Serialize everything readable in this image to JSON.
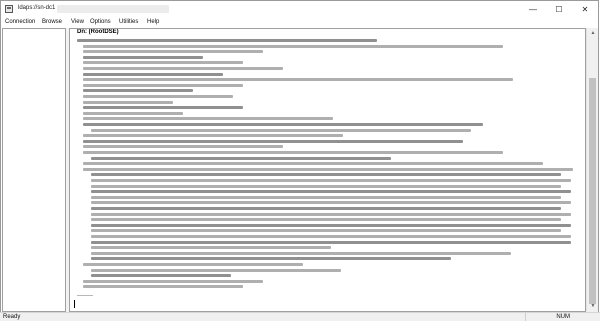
{
  "window": {
    "title_prefix": "ldaps://sn-dc1",
    "minimize_glyph": "—",
    "maximize_glyph": "☐",
    "close_glyph": "✕"
  },
  "menu": [
    "Connection",
    "Browse",
    "View",
    "Options",
    "Utilities",
    "Help"
  ],
  "content": {
    "dn_heading": "Dn: (RootDSE)",
    "separator": "--------"
  },
  "scrollbar": {
    "up_glyph": "▲",
    "down_glyph": "▼"
  },
  "status": {
    "left": "Ready",
    "num": "NUM"
  },
  "icons": {
    "app": "ldp-window-icon"
  }
}
